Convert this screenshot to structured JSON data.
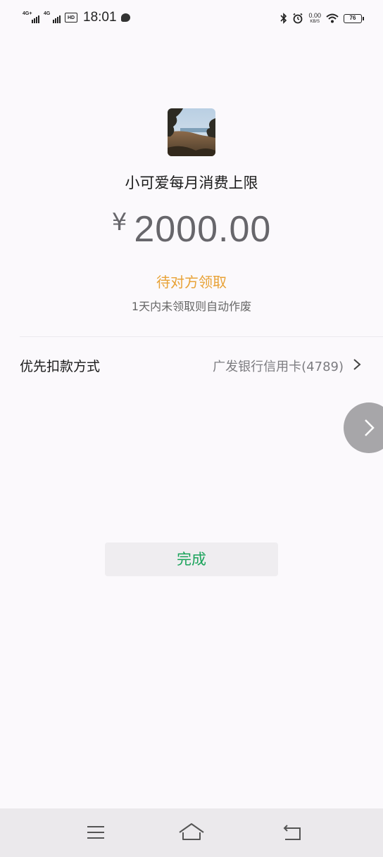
{
  "status_bar": {
    "signal1_label": "4G+",
    "signal2_label": "4G",
    "hd_label": "HD",
    "time": "18:01",
    "net_speed_value": "0.00",
    "net_speed_unit": "KB/S",
    "battery_level": "76",
    "icons": [
      "signal-icon",
      "hd-icon",
      "chat-bubble-icon",
      "bluetooth-icon",
      "alarm-icon",
      "wifi-icon",
      "battery-icon"
    ]
  },
  "payment": {
    "title": "小可爱每月消费上限",
    "currency_symbol": "¥",
    "amount": "2000.00",
    "status": "待对方领取",
    "hint": "1天内未领取则自动作废"
  },
  "pay_method": {
    "label": "优先扣款方式",
    "value": "广发银行信用卡(4789)"
  },
  "actions": {
    "done_label": "完成"
  },
  "nav": {
    "icons": [
      "menu-icon",
      "home-icon",
      "back-icon"
    ]
  },
  "colors": {
    "background": "#fbf9fc",
    "accent_green": "#1aa35a",
    "status_orange": "#e8a236",
    "amount_gray": "#67666b"
  }
}
